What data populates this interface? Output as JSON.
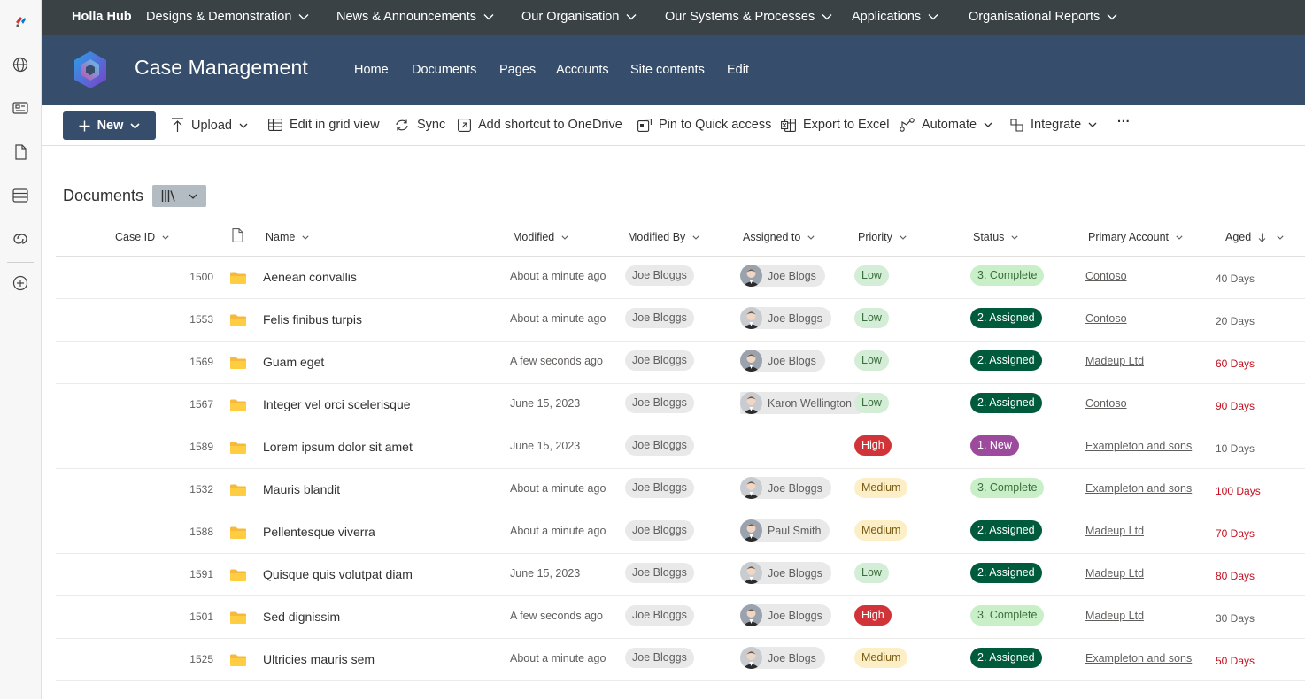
{
  "hub": {
    "title": "Holla Hub",
    "items": [
      {
        "label": "Designs & Demonstration"
      },
      {
        "label": "News & Announcements"
      },
      {
        "label": "Our Organisation"
      },
      {
        "label": "Our Systems & Processes"
      },
      {
        "label": "Applications"
      },
      {
        "label": "Organisational Reports"
      }
    ]
  },
  "site": {
    "title": "Case Management",
    "nav": [
      "Home",
      "Documents",
      "Pages",
      "Accounts",
      "Site contents",
      "Edit"
    ]
  },
  "commands": {
    "new_label": "New",
    "upload": "Upload",
    "edit_grid": "Edit in grid view",
    "sync": "Sync",
    "shortcut": "Add shortcut to OneDrive",
    "pin": "Pin to Quick access",
    "export": "Export to Excel",
    "automate": "Automate",
    "integrate": "Integrate",
    "more": "···"
  },
  "library": {
    "title": "Documents"
  },
  "columns": {
    "case_id": "Case ID",
    "name": "Name",
    "modified": "Modified",
    "modified_by": "Modified By",
    "assigned_to": "Assigned to",
    "priority": "Priority",
    "status": "Status",
    "primary_account": "Primary Account",
    "aged": "Aged"
  },
  "colors": {
    "hub_bg": "#3b4246",
    "header_bg": "#364e6b",
    "overdue": "#c50f1f"
  },
  "rows": [
    {
      "id": "1500",
      "name": "Aenean convallis",
      "modified": "About a minute ago",
      "modified_by": "Joe Bloggs",
      "assigned": "Joe Blogs",
      "priority": "Low",
      "status": "3. Complete",
      "account": "Contoso",
      "aged": "40 Days",
      "overdue": false
    },
    {
      "id": "1553",
      "name": "Felis finibus turpis",
      "modified": "About a minute ago",
      "modified_by": "Joe Bloggs",
      "assigned": "Joe Bloggs",
      "priority": "Low",
      "status": "2. Assigned",
      "account": "Contoso",
      "aged": "20 Days",
      "overdue": false
    },
    {
      "id": "1569",
      "name": "Guam eget",
      "modified": "A few seconds ago",
      "modified_by": "Joe Bloggs",
      "assigned": "Joe Blogs",
      "priority": "Low",
      "status": "2. Assigned",
      "account": "Madeup Ltd",
      "aged": "60 Days",
      "overdue": true
    },
    {
      "id": "1567",
      "name": "Integer vel orci scelerisque",
      "modified": "June 15, 2023",
      "modified_by": "Joe Bloggs",
      "assigned": "Karon Wellington",
      "priority": "Low",
      "status": "2. Assigned",
      "account": "Contoso",
      "aged": "90 Days",
      "overdue": true
    },
    {
      "id": "1589",
      "name": "Lorem ipsum dolor sit amet",
      "modified": "June 15, 2023",
      "modified_by": "Joe Bloggs",
      "assigned": "",
      "priority": "High",
      "status": "1. New",
      "account": "Exampleton and sons",
      "aged": "10 Days",
      "overdue": false
    },
    {
      "id": "1532",
      "name": "Mauris blandit",
      "modified": "About a minute ago",
      "modified_by": "Joe Bloggs",
      "assigned": "Joe Bloggs",
      "priority": "Medium",
      "status": "3. Complete",
      "account": "Exampleton and sons",
      "aged": "100 Days",
      "overdue": true
    },
    {
      "id": "1588",
      "name": "Pellentesque viverra",
      "modified": "About a minute ago",
      "modified_by": "Joe Bloggs",
      "assigned": "Paul Smith",
      "priority": "Medium",
      "status": "2. Assigned",
      "account": "Madeup Ltd",
      "aged": "70 Days",
      "overdue": true
    },
    {
      "id": "1591",
      "name": "Quisque quis volutpat diam",
      "modified": "June 15, 2023",
      "modified_by": "Joe Bloggs",
      "assigned": "Joe Bloggs",
      "priority": "Low",
      "status": "2. Assigned",
      "account": "Madeup Ltd",
      "aged": "80 Days",
      "overdue": true
    },
    {
      "id": "1501",
      "name": "Sed dignissim",
      "modified": "A few seconds ago",
      "modified_by": "Joe Bloggs",
      "assigned": "Joe Bloggs",
      "priority": "High",
      "status": "3. Complete",
      "account": "Madeup Ltd",
      "aged": "30 Days",
      "overdue": false
    },
    {
      "id": "1525",
      "name": "Ultricies mauris sem",
      "modified": "About a minute ago",
      "modified_by": "Joe Bloggs",
      "assigned": "Joe Blogs",
      "priority": "Medium",
      "status": "2. Assigned",
      "account": "Exampleton and sons",
      "aged": "50 Days",
      "overdue": true
    }
  ]
}
